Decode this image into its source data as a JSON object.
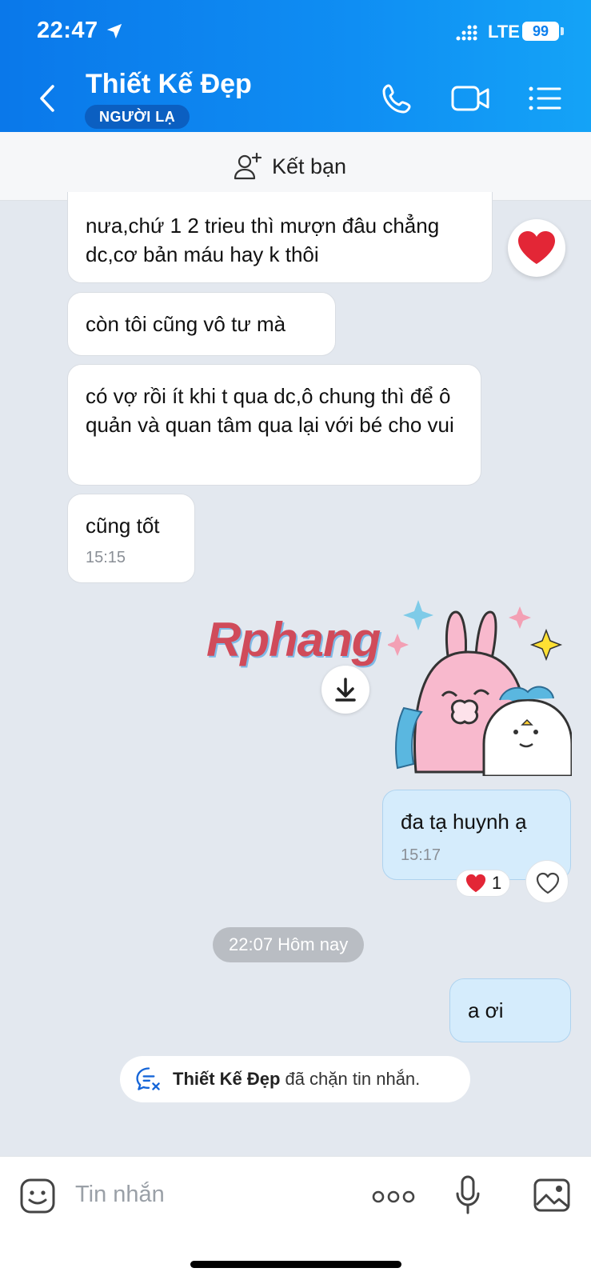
{
  "status_bar": {
    "time": "22:47",
    "network": "LTE",
    "battery": "99"
  },
  "header": {
    "title": "Thiết Kế Đẹp",
    "badge": "NGƯỜI LẠ"
  },
  "add_friend": {
    "label": "Kết bạn"
  },
  "messages": [
    {
      "text": "nưa,chứ 1 2 trieu thì mượn đâu chẳng dc,cơ bản máu hay k thôi"
    },
    {
      "text": "còn tôi cũng vô tư mà"
    },
    {
      "text": "có vợ rồi ít khi t qua dc,ô chung thì để ô quản và quan tâm qua lại với bé cho vui"
    },
    {
      "text": "cũng tốt",
      "time": "15:15"
    }
  ],
  "watermark": "Rphang",
  "my_messages": [
    {
      "text": "đa tạ huynh ạ",
      "time": "15:17",
      "reaction_count": "1"
    },
    {
      "text": "a ơi"
    }
  ],
  "date_divider": "22:07 Hôm nay",
  "block_notice": {
    "name": "Thiết Kế Đẹp",
    "text": "đã chặn tin nhắn."
  },
  "input": {
    "placeholder": "Tin nhắn"
  },
  "colors": {
    "header_start": "#0a78ea",
    "header_end": "#14a3f7",
    "my_bubble": "#d5ecfc",
    "chat_bg": "#e3e8ef"
  }
}
